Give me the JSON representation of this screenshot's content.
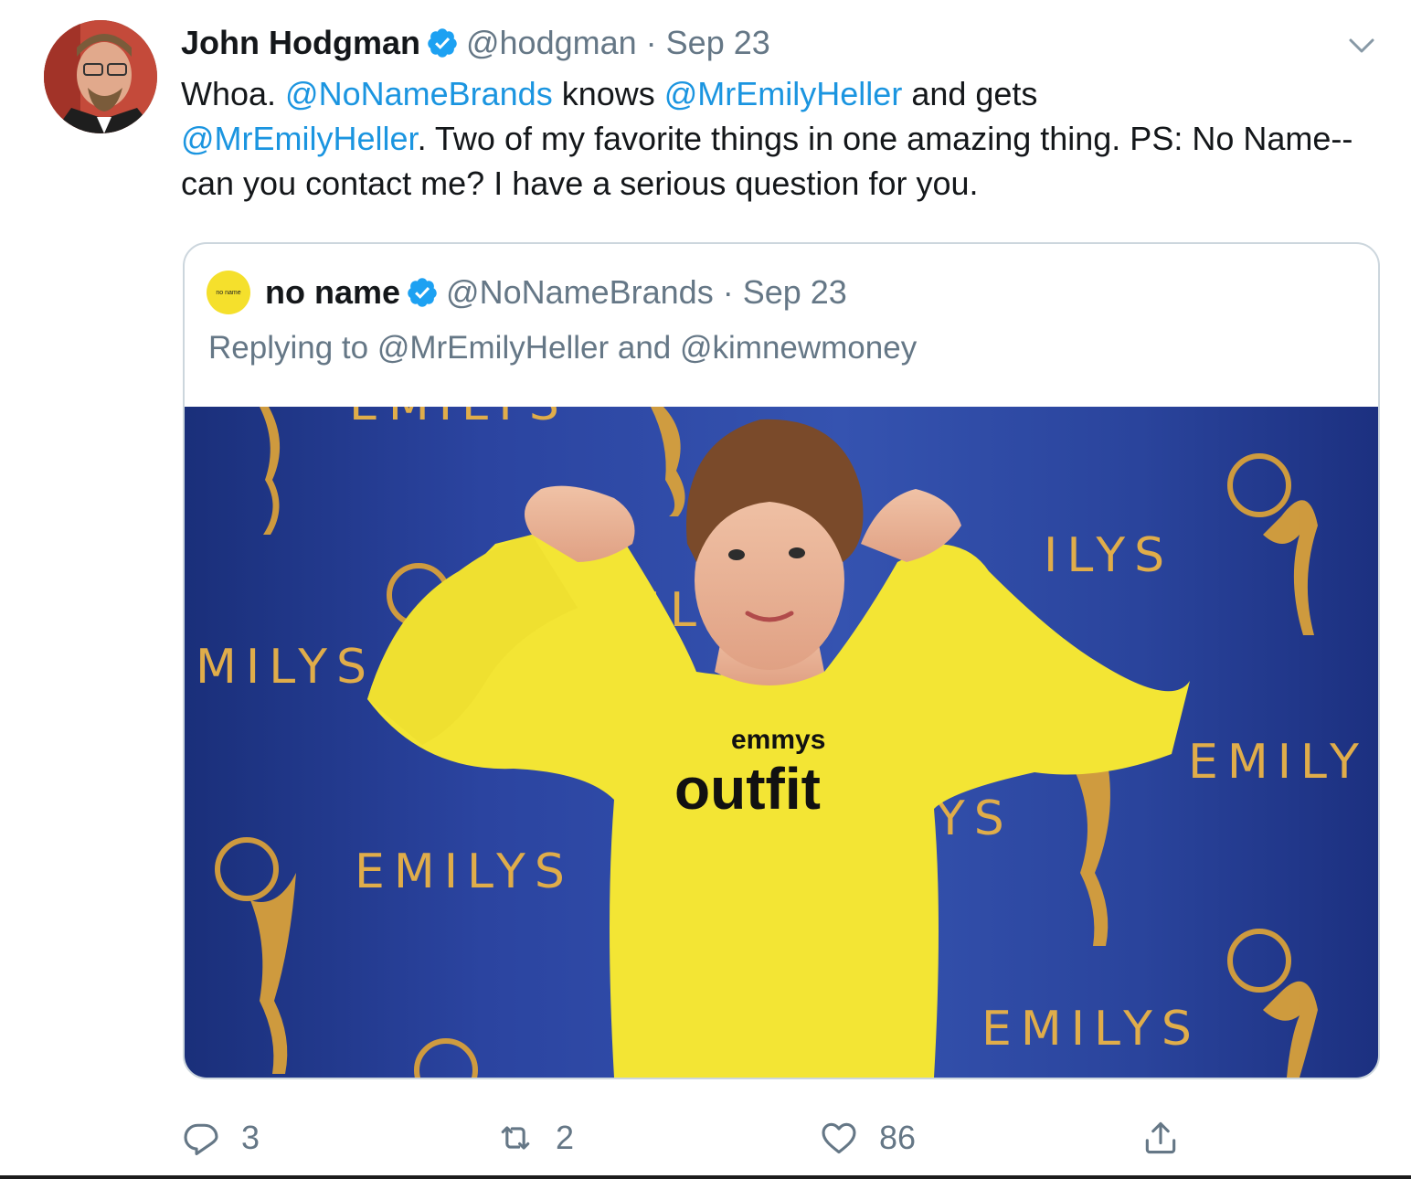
{
  "tweet": {
    "author_name": "John Hodgman",
    "handle": "@hodgman",
    "separator": "·",
    "date": "Sep 23",
    "text_parts": {
      "p1": "Whoa. ",
      "m1": "@NoNameBrands",
      "p2": " knows ",
      "m2": "@MrEmilyHeller",
      "p3": " and gets ",
      "m3": "@MrEmilyHeller",
      "p4": ". Two of my favorite things in one amazing thing. PS: No Name--can you contact me? I have a serious  question for you."
    }
  },
  "quote": {
    "logo_text": "no name",
    "author_name": "no name",
    "handle": "@NoNameBrands",
    "separator": "·",
    "date": "Sep 23",
    "replying": "Replying to @MrEmilyHeller and @kimnewmoney",
    "image": {
      "backdrop_words": [
        "EMILYS",
        "MILYS",
        "EMIL",
        "ILYS",
        "EMILY",
        "EMILYS",
        "EMILYS",
        "YS"
      ],
      "shirt_small": "emmys",
      "shirt_large": "outfit"
    }
  },
  "actions": {
    "reply_count": "3",
    "retweet_count": "2",
    "like_count": "86"
  },
  "icons": {
    "verified": "verified-badge-icon",
    "caret": "chevron-down-icon",
    "reply": "reply-icon",
    "retweet": "retweet-icon",
    "like": "heart-icon",
    "share": "share-icon"
  },
  "colors": {
    "mention": "#1b95e0",
    "muted": "#657786",
    "shirt_yellow": "#f3e534",
    "backdrop_blue": "#2b44a0",
    "emmy_gold": "#d8a13a"
  }
}
